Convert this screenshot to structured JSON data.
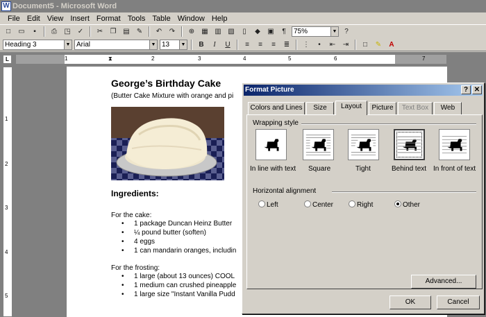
{
  "window": {
    "title": "Document5 - Microsoft Word",
    "icon": "word-icon"
  },
  "menu": [
    "File",
    "Edit",
    "View",
    "Insert",
    "Format",
    "Tools",
    "Table",
    "Window",
    "Help"
  ],
  "toolbar": {
    "zoom": "75%",
    "style": "Heading 3",
    "font": "Arial",
    "size": "13",
    "bold_label": "B",
    "italic_label": "I",
    "underline_label": "U"
  },
  "ruler": {
    "ticks": [
      "1",
      "2",
      "3",
      "4",
      "5",
      "6",
      "7"
    ],
    "vticks": [
      "1",
      "2",
      "3",
      "4",
      "5"
    ]
  },
  "document": {
    "title": "George’s Birthday Cake",
    "subtitle": "(Butter Cake Mixture with orange and pi",
    "ingredients_heading": "Ingredients:",
    "cake_heading": "For the cake:",
    "cake_items": [
      "1 package Duncan Heinz Butter",
      "¼ pound butter (soften)",
      "4 eggs",
      "1 can mandarin oranges, includin"
    ],
    "frosting_heading": "For the frosting:",
    "frosting_items": [
      "1 large (about 13 ounces) COOL",
      "1 medium can crushed pineapple",
      "1 large size \"Instant Vanilla Pudd"
    ]
  },
  "dialog": {
    "title": "Format Picture",
    "help_label": "?",
    "close_label": "✕",
    "tabs": [
      "Colors and Lines",
      "Size",
      "Layout",
      "Picture",
      "Text Box",
      "Web"
    ],
    "active_tab": "Layout",
    "wrapping_style_label": "Wrapping style",
    "wrapping_options": [
      "In line with text",
      "Square",
      "Tight",
      "Behind text",
      "In front of text"
    ],
    "selected_wrap": "Behind text",
    "alignment_label": "Horizontal alignment",
    "alignment_options": [
      "Left",
      "Center",
      "Right",
      "Other"
    ],
    "selected_alignment": "Other",
    "advanced_label": "Advanced...",
    "ok_label": "OK",
    "cancel_label": "Cancel"
  }
}
